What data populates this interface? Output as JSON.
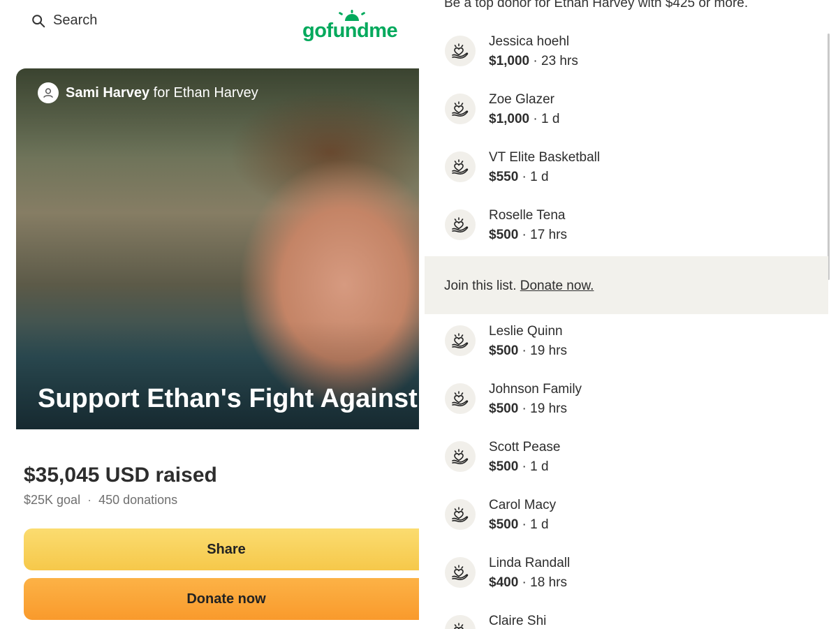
{
  "header": {
    "search_label": "Search",
    "logo_text": "gofundme"
  },
  "campaign": {
    "organizer_name": "Sami Harvey",
    "organizer_suffix": "for Ethan Harvey",
    "title": "Support Ethan's Fight Against Br",
    "raised": "$35,045 USD raised",
    "goal": "$25K goal",
    "donations": "450 donations",
    "share_label": "Share",
    "donate_label": "Donate now"
  },
  "top_donors": {
    "header_text": "Be a top donor for Ethan Harvey with $425 or more.",
    "join_text": "Join this list.",
    "join_link": "Donate now.",
    "list_a": [
      {
        "name": "Jessica hoehl",
        "amount": "$1,000",
        "time": "23 hrs"
      },
      {
        "name": "Zoe Glazer",
        "amount": "$1,000",
        "time": "1 d"
      },
      {
        "name": "VT Elite Basketball",
        "amount": "$550",
        "time": "1 d"
      },
      {
        "name": "Roselle Tena",
        "amount": "$500",
        "time": "17 hrs"
      }
    ],
    "list_b": [
      {
        "name": "Leslie Quinn",
        "amount": "$500",
        "time": "19 hrs"
      },
      {
        "name": "Johnson Family",
        "amount": "$500",
        "time": "19 hrs"
      },
      {
        "name": "Scott Pease",
        "amount": "$500",
        "time": "1 d"
      },
      {
        "name": "Carol Macy",
        "amount": "$500",
        "time": "1 d"
      },
      {
        "name": "Linda Randall",
        "amount": "$400",
        "time": "18 hrs"
      },
      {
        "name": "Claire Shi",
        "amount": "",
        "time": ""
      }
    ]
  },
  "colors": {
    "brand_green": "#02a95c",
    "share_yellow": "#f6c84a",
    "donate_orange": "#f99a2c",
    "join_bg": "#f2f1ec"
  },
  "icons": {
    "search": "search-icon",
    "organizer": "user-icon",
    "donor": "heart-in-hand-icon"
  }
}
